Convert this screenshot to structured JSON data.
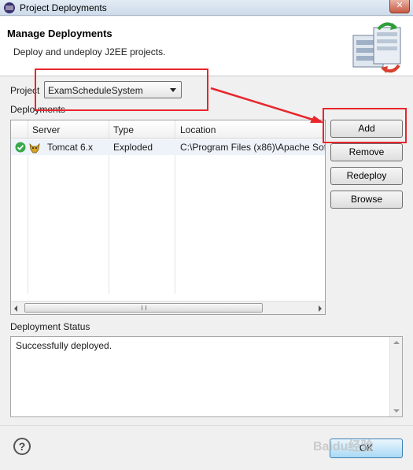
{
  "window": {
    "title": "Project Deployments",
    "close_glyph": "✕"
  },
  "header": {
    "title": "Manage Deployments",
    "subtitle": "Deploy and undeploy J2EE projects."
  },
  "project": {
    "label": "Project",
    "selected": "ExamScheduleSystem"
  },
  "deployments": {
    "label": "Deployments",
    "columns": [
      "Server",
      "Type",
      "Location"
    ],
    "rows": [
      {
        "status": "deployed",
        "server": "Tomcat  6.x",
        "type": "Exploded",
        "location": "C:\\Program Files (x86)\\Apache Soft"
      }
    ]
  },
  "buttons": {
    "add": "Add",
    "remove": "Remove",
    "redeploy": "Redeploy",
    "browse": "Browse"
  },
  "status": {
    "label": "Deployment Status",
    "message": "Successfully deployed."
  },
  "footer": {
    "help": "?",
    "ok": "OK",
    "watermark": "Baidu经验"
  },
  "colors": {
    "highlight": "#e8262c",
    "selected_row": "#eef3fa",
    "ok_button": "#a9d9f5"
  },
  "icons": {
    "window": "eclipse-icon",
    "banner": "server-deploy-icon",
    "row_status": "green-check-icon",
    "row_server": "tomcat-icon",
    "help": "help-icon"
  }
}
